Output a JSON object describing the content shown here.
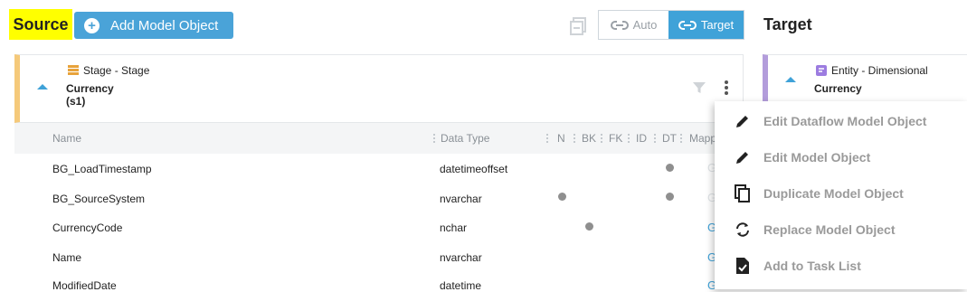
{
  "header": {
    "source_title": "Source",
    "add_button_label": "Add Model Object",
    "target_title": "Target",
    "mode": {
      "auto_label": "Auto",
      "target_label": "Target",
      "selected": "Target"
    }
  },
  "source_object": {
    "layer_label": "Stage - Stage",
    "name_line1": "Currency",
    "name_line2": "(s1)"
  },
  "columns": {
    "name": "Name",
    "data_type": "Data Type",
    "n": "N",
    "bk": "BK",
    "fk": "FK",
    "id": "ID",
    "dt": "DT",
    "mapping": "Mapp"
  },
  "rows": [
    {
      "name": "BG_LoadTimestamp",
      "data_type": "datetimeoffset",
      "n": false,
      "bk": false,
      "dt": true
    },
    {
      "name": "BG_SourceSystem",
      "data_type": "nvarchar",
      "n": true,
      "bk": false,
      "dt": true
    },
    {
      "name": "CurrencyCode",
      "data_type": "nchar",
      "n": false,
      "bk": true,
      "dt": false
    },
    {
      "name": "Name",
      "data_type": "nvarchar",
      "n": false,
      "bk": false,
      "dt": false
    },
    {
      "name": "ModifiedDate",
      "data_type": "datetime",
      "n": false,
      "bk": false,
      "dt": false
    }
  ],
  "target_object": {
    "layer_label": "Entity - Dimensional",
    "name_line1": "Currency"
  },
  "context_menu": {
    "items": [
      {
        "label": "Edit Dataflow Model Object",
        "icon": "pencil-icon"
      },
      {
        "label": "Edit Model Object",
        "icon": "pencil-icon"
      },
      {
        "label": "Duplicate Model Object",
        "icon": "copy-icon"
      },
      {
        "label": "Replace Model Object",
        "icon": "replace-icon"
      },
      {
        "label": "Add to Task List",
        "icon": "task-list-icon"
      }
    ]
  },
  "colors": {
    "accent": "#3fa2d8",
    "stage_bar": "#f5c97a",
    "entity_bar": "#b39ddb",
    "highlight": "#ffff00"
  }
}
